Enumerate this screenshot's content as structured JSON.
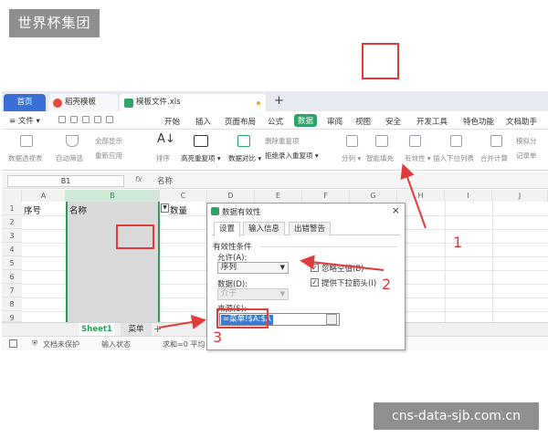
{
  "watermark_top": "世界杯集团",
  "watermark_bottom": "cns-data-sjb.com.cn",
  "tabs": [
    {
      "label": "首页"
    },
    {
      "label": "稻壳模板"
    },
    {
      "label": "模板文件.xls"
    }
  ],
  "tab_add": "+",
  "menu": {
    "file": "≡ 文件 ▾",
    "items": [
      "开始",
      "插入",
      "页面布局",
      "公式",
      "数据",
      "审阅",
      "视图",
      "安全",
      "开发工具",
      "特色功能",
      "文档助手"
    ],
    "active": "数据"
  },
  "ribbon": {
    "pivot": "数据透视表",
    "auto_filter": "自动筛选",
    "show_all": "全部显示",
    "reapply": "重新应用",
    "sort": "排序",
    "highlight_dup": "高亮重复项 ▾",
    "compare": "数据对比 ▾",
    "remove_dup": "删除重复项",
    "reject_dup": "拒绝录入重复项 ▾",
    "split": "分列 ▾",
    "smart_fill": "智能填充",
    "validity": "有效性 ▾",
    "dropdown": "插入下拉列表",
    "merge_calc": "合并计算",
    "simulate": "模拟分",
    "record": "记录单"
  },
  "formula_bar": {
    "cell_ref": "B1",
    "fx": "fx",
    "value": "名称"
  },
  "grid": {
    "columns": [
      "A",
      "B",
      "C",
      "D",
      "E",
      "F",
      "G",
      "H",
      "I",
      "J"
    ],
    "rows": [
      "1",
      "2",
      "3",
      "4",
      "5",
      "6",
      "7",
      "8",
      "9"
    ],
    "a1": "序号",
    "b1": "名称",
    "c1": "数量"
  },
  "sheets": [
    "Sheet1",
    "菜单"
  ],
  "sheet_add": "+",
  "status": {
    "protect": "文档未保护",
    "input": "输入状态",
    "sum": "求和=0 平均"
  },
  "dialog": {
    "title": "数据有效性",
    "close": "×",
    "tabs": [
      "设置",
      "输入信息",
      "出错警告"
    ],
    "section": "有效性条件",
    "allow_label": "允许(A):",
    "allow_value": "序列",
    "ignore_blank": "忽略空值(B)",
    "data_label": "数据(D):",
    "data_value": "介于",
    "dropdown_arrow": "提供下拉箭头(I)",
    "source_label": "来源(S):",
    "source_value": "=菜单!$A:$A"
  },
  "annotations": [
    "1",
    "2",
    "3"
  ],
  "colors": {
    "accent_green": "#2ea566",
    "tab_blue": "#3a6fd8",
    "highlight_red": "#e23b3b"
  }
}
